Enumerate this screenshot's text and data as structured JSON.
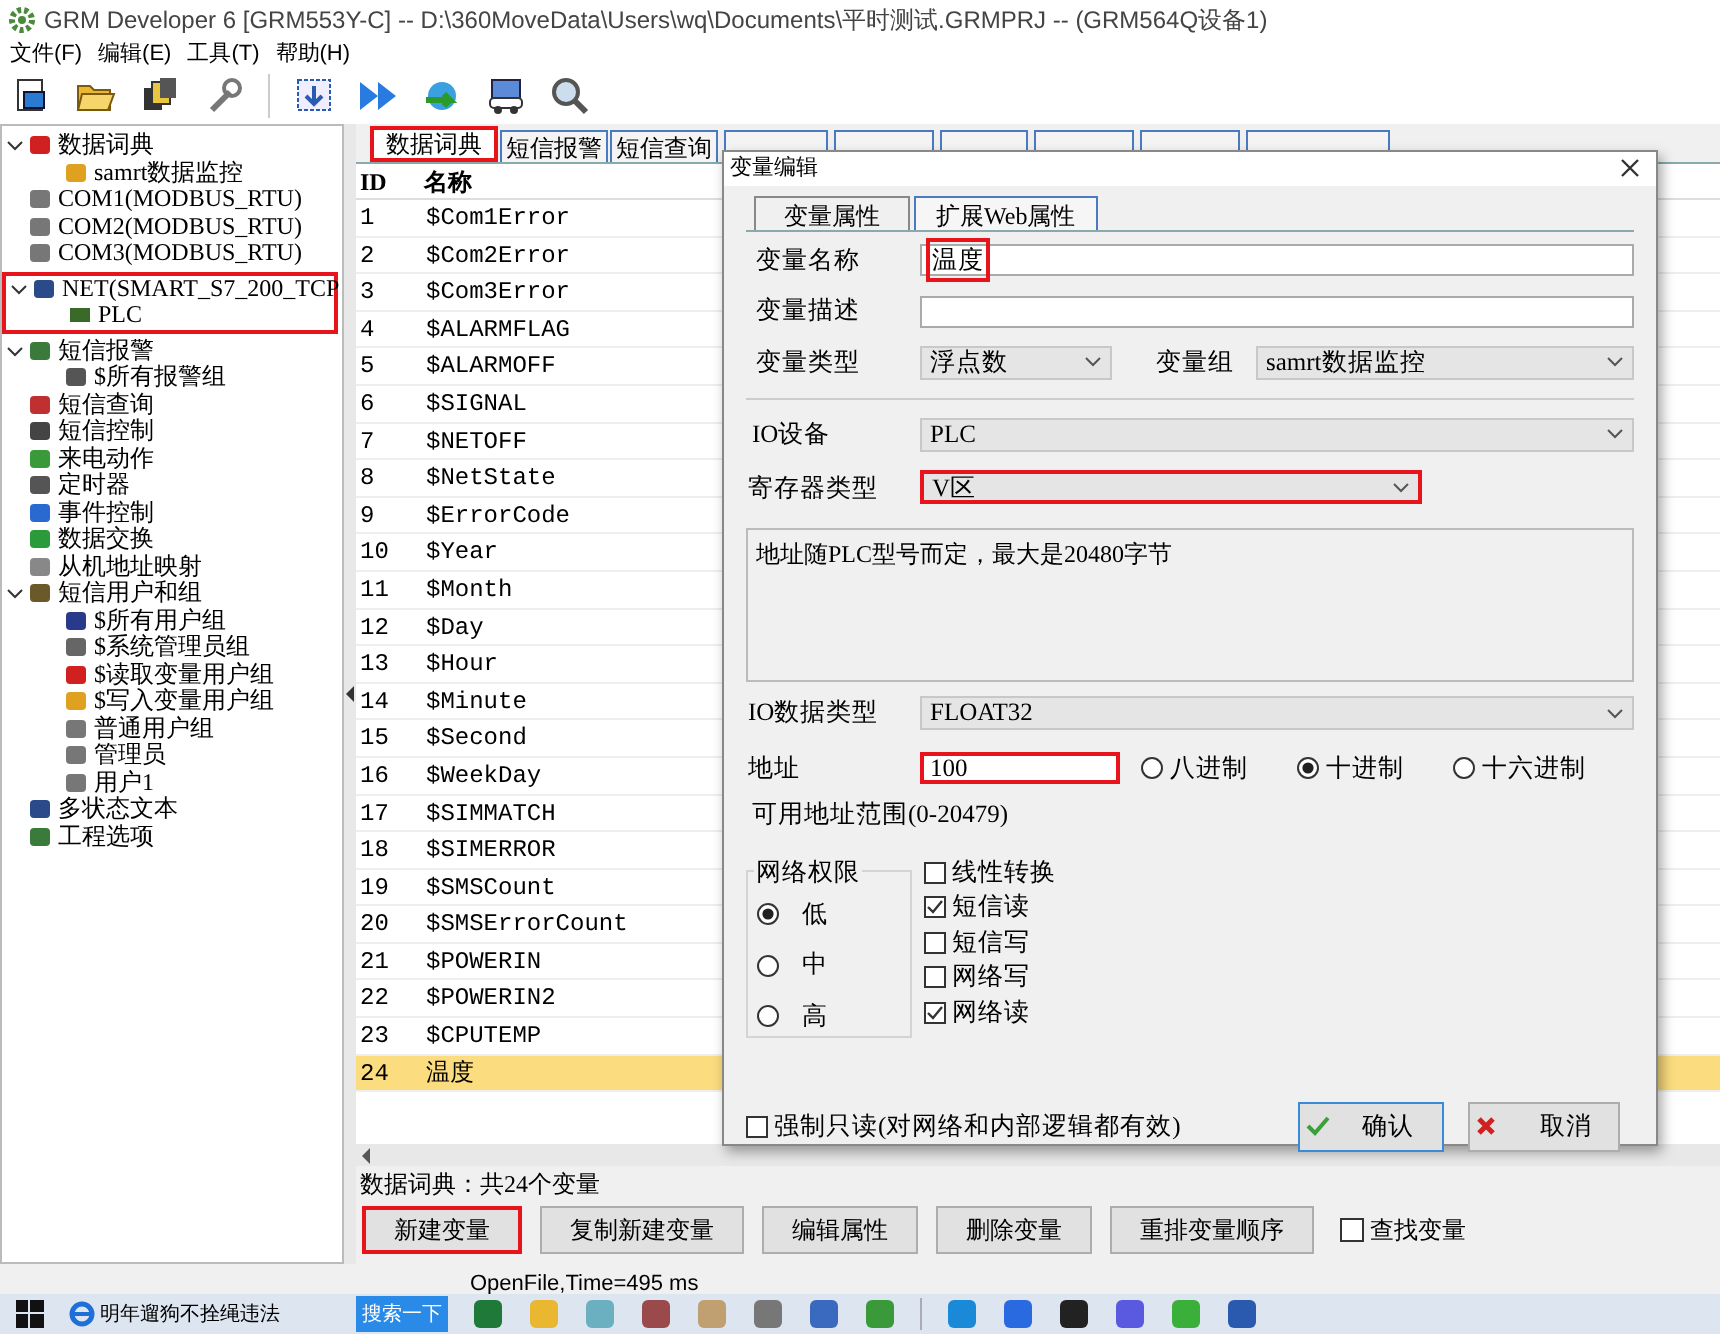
{
  "window": {
    "title": "GRM Developer 6 [GRM553Y-C]  -- D:\\360MoveData\\Users\\wq\\Documents\\平时测试.GRMPRJ -- (GRM564Q设备1)"
  },
  "menu": [
    "文件(F)",
    "编辑(E)",
    "工具(T)",
    "帮助(H)"
  ],
  "tree": [
    {
      "label": "数据词典",
      "expanded": true,
      "children": [
        {
          "label": "samrt数据监控"
        }
      ]
    },
    {
      "label": "COM1(MODBUS_RTU)"
    },
    {
      "label": "COM2(MODBUS_RTU)"
    },
    {
      "label": "COM3(MODBUS_RTU)"
    },
    {
      "label": "NET(SMART_S7_200_TCP",
      "expanded": true,
      "highlighted": true,
      "children": [
        {
          "label": "PLC"
        }
      ]
    },
    {
      "label": "短信报警",
      "expanded": true,
      "children": [
        {
          "label": "$所有报警组"
        }
      ]
    },
    {
      "label": "短信查询"
    },
    {
      "label": "短信控制"
    },
    {
      "label": "来电动作"
    },
    {
      "label": "定时器"
    },
    {
      "label": "事件控制"
    },
    {
      "label": "数据交换"
    },
    {
      "label": "从机地址映射"
    },
    {
      "label": "短信用户和组",
      "expanded": true,
      "children": [
        {
          "label": "$所有用户组"
        },
        {
          "label": "$系统管理员组"
        },
        {
          "label": "$读取变量用户组"
        },
        {
          "label": "$写入变量用户组"
        },
        {
          "label": "普通用户组"
        },
        {
          "label": "管理员"
        },
        {
          "label": "用户1"
        }
      ]
    },
    {
      "label": "多状态文本"
    },
    {
      "label": "工程选项"
    }
  ],
  "tabs": [
    {
      "label": "数据词典",
      "selected": true,
      "highlighted": true
    },
    {
      "label": "短信报警",
      "selected": false
    },
    {
      "label": "短信查询",
      "selected": false
    }
  ],
  "table": {
    "columns": [
      "ID",
      "名称"
    ],
    "rows": [
      {
        "id": "1",
        "name": "$Com1Error",
        "selected": false
      },
      {
        "id": "2",
        "name": "$Com2Error",
        "selected": false
      },
      {
        "id": "3",
        "name": "$Com3Error",
        "selected": false
      },
      {
        "id": "4",
        "name": "$ALARMFLAG",
        "selected": false
      },
      {
        "id": "5",
        "name": "$ALARMOFF",
        "selected": false
      },
      {
        "id": "6",
        "name": "$SIGNAL",
        "selected": false
      },
      {
        "id": "7",
        "name": "$NETOFF",
        "selected": false
      },
      {
        "id": "8",
        "name": "$NetState",
        "selected": false
      },
      {
        "id": "9",
        "name": "$ErrorCode",
        "selected": false
      },
      {
        "id": "10",
        "name": "$Year",
        "selected": false
      },
      {
        "id": "11",
        "name": "$Month",
        "selected": false
      },
      {
        "id": "12",
        "name": "$Day",
        "selected": false
      },
      {
        "id": "13",
        "name": "$Hour",
        "selected": false
      },
      {
        "id": "14",
        "name": "$Minute",
        "selected": false
      },
      {
        "id": "15",
        "name": "$Second",
        "selected": false
      },
      {
        "id": "16",
        "name": "$WeekDay",
        "selected": false
      },
      {
        "id": "17",
        "name": "$SIMMATCH",
        "selected": false
      },
      {
        "id": "18",
        "name": "$SIMERROR",
        "selected": false
      },
      {
        "id": "19",
        "name": "$SMSCount",
        "selected": false
      },
      {
        "id": "20",
        "name": "$SMSErrorCount",
        "selected": false
      },
      {
        "id": "21",
        "name": "$POWERIN",
        "selected": false
      },
      {
        "id": "22",
        "name": "$POWERIN2",
        "selected": false
      },
      {
        "id": "23",
        "name": "$CPUTEMP",
        "selected": false
      },
      {
        "id": "24",
        "name": "温度",
        "selected": true
      }
    ]
  },
  "summary": "数据词典：共24个变量",
  "buttons": [
    {
      "label": "新建变量",
      "highlighted": true
    },
    {
      "label": "复制新建变量",
      "highlighted": false
    },
    {
      "label": "编辑属性",
      "highlighted": false
    },
    {
      "label": "删除变量",
      "highlighted": false
    },
    {
      "label": "重排变量顺序",
      "highlighted": false
    }
  ],
  "find_checkbox": {
    "label": "查找变量",
    "checked": false
  },
  "status": "OpenFile,Time=495 ms",
  "dialog": {
    "title": "变量编辑",
    "tabs": [
      {
        "label": "变量属性",
        "selected": true
      },
      {
        "label": "扩展Web属性",
        "selected": false
      }
    ],
    "name": {
      "label": "变量名称",
      "value": "温度",
      "highlighted": true
    },
    "description": {
      "label": "变量描述"
    },
    "type": {
      "label": "变量类型",
      "value": "浮点数"
    },
    "group": {
      "label": "变量组",
      "value": "samrt数据监控"
    },
    "io_device": {
      "label": "IO设备",
      "value": "PLC"
    },
    "register_type": {
      "label": "寄存器类型",
      "value": "V区",
      "highlighted": true
    },
    "note": "地址随PLC型号而定，最大是20480字节",
    "io_data_type": {
      "label": "IO数据类型",
      "value": "FLOAT32"
    },
    "address": {
      "label": "地址",
      "value": "100",
      "highlighted": true
    },
    "radix": [
      {
        "label": "八进制",
        "selected": false
      },
      {
        "label": "十进制",
        "selected": true
      },
      {
        "label": "十六进制",
        "selected": false
      }
    ],
    "range": "可用地址范围(0-20479)",
    "permission": {
      "title": "网络权限",
      "options": [
        {
          "label": "低",
          "selected": true
        },
        {
          "label": "中",
          "selected": false
        },
        {
          "label": "高",
          "selected": false
        }
      ]
    },
    "checkboxes": [
      {
        "label": "线性转换",
        "checked": false
      },
      {
        "label": "短信读",
        "checked": true
      },
      {
        "label": "短信写",
        "checked": false
      },
      {
        "label": "网络写",
        "checked": false
      },
      {
        "label": "网络读",
        "checked": true
      }
    ],
    "force_readonly": {
      "label": "强制只读(对网络和内部逻辑都有效)",
      "checked": false
    },
    "ok": "确认",
    "cancel": "取消"
  },
  "taskbar": {
    "search_text": "明年遛狗不拴绳违法",
    "search_button": "搜索一下"
  }
}
